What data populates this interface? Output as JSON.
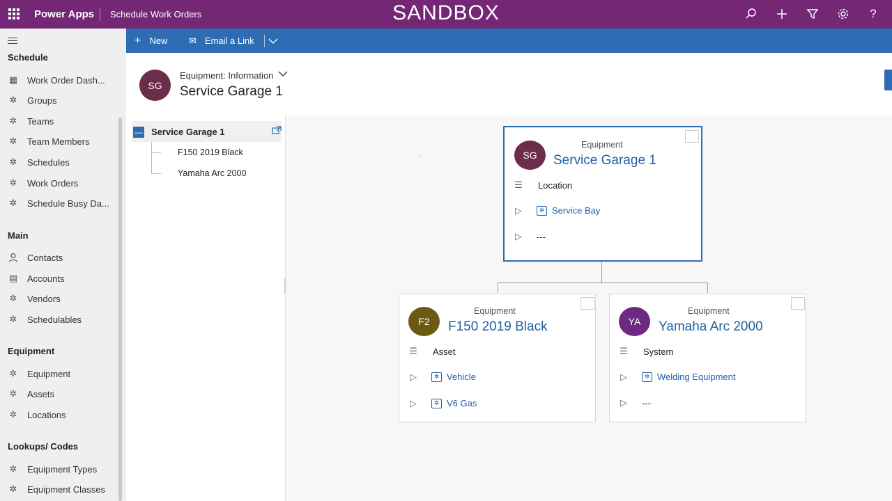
{
  "topbar": {
    "app_name": "Power Apps",
    "app_title": "Schedule Work Orders",
    "environment_banner": "SANDBOX",
    "icons": [
      "search-icon",
      "plus-icon",
      "filter-icon",
      "settings-icon",
      "help-icon"
    ],
    "color": "#742774"
  },
  "leftnav": {
    "sections": [
      {
        "title": "Schedule",
        "items": [
          "Work Order Dash...",
          "Groups",
          "Teams",
          "Team Members",
          "Schedules",
          "Work Orders",
          "Schedule Busy Da..."
        ]
      },
      {
        "title": "Main",
        "items": [
          "Contacts",
          "Accounts",
          "Vendors",
          "Schedulables"
        ]
      },
      {
        "title": "Equipment",
        "items": [
          "Equipment",
          "Assets",
          "Locations"
        ]
      },
      {
        "title": "Lookups/ Codes",
        "items": [
          "Equipment Types",
          "Equipment Classes"
        ]
      }
    ]
  },
  "cmdbar": {
    "new_label": "New",
    "email_label": "Email a Link",
    "color": "#2e6db4"
  },
  "header": {
    "initials": "SG",
    "form_label": "Equipment: Information",
    "record_name": "Service Garage 1"
  },
  "tree": {
    "root": "Service Garage 1",
    "children": [
      "F150 2019 Black",
      "Yamaha Arc 2000"
    ]
  },
  "cards": {
    "root": {
      "initials": "SG",
      "avatar_color": "#6b2d4a",
      "type": "Equipment",
      "name": "Service Garage 1",
      "field1": "Location",
      "field2": "Service Bay",
      "field3": "---"
    },
    "left": {
      "initials": "F2",
      "avatar_color": "#6b5a12",
      "type": "Equipment",
      "name": "F150 2019 Black",
      "field1": "Asset",
      "field2": "Vehicle",
      "field3": "V6 Gas"
    },
    "right": {
      "initials": "YA",
      "avatar_color": "#6e2a80",
      "type": "Equipment",
      "name": "Yamaha Arc 2000",
      "field1": "System",
      "field2": "Welding Equipment",
      "field3": "---"
    }
  }
}
